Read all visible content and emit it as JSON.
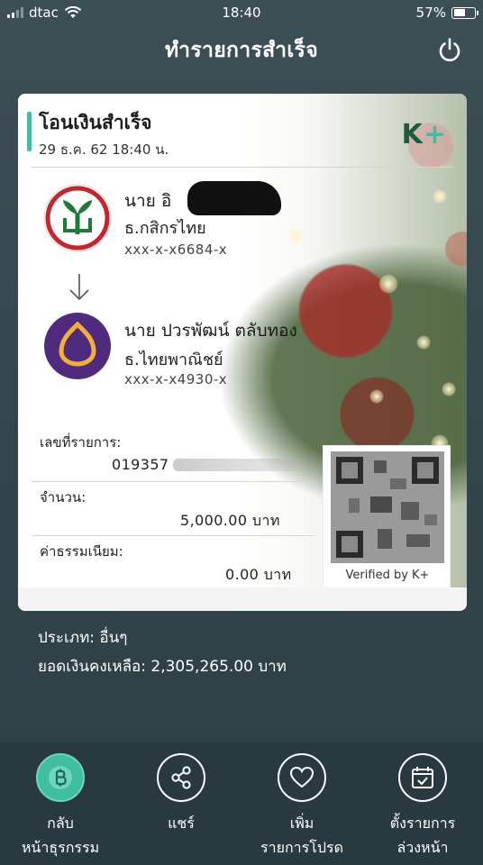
{
  "status_bar": {
    "carrier": "dtac",
    "time": "18:40",
    "battery": "57%",
    "battery_level": 0.57
  },
  "header": {
    "title": "ทำรายการสำเร็จ",
    "power_icon": "power-icon"
  },
  "slip": {
    "title": "โอนเงินสำเร็จ",
    "datetime": "29 ธ.ค. 62 18:40 น.",
    "logo": "K+",
    "sender": {
      "name": "นาย อิ",
      "bank": "ธ.กสิกรไทย",
      "account": "xxx-x-x6684-x",
      "logo_color": "#1e7a3b"
    },
    "receiver": {
      "name": "นาย ปวรพัฒน์ ตลับทอง",
      "bank": "ธ.ไทยพาณิชย์",
      "account": "xxx-x-x4930-x",
      "logo_color": "#4f2a7d"
    },
    "transaction_label": "เลขที่รายการ:",
    "transaction_value": "019357",
    "amount_label": "จำนวน:",
    "amount_value": "5,000.00  บาท",
    "fee_label": "ค่าธรรมเนียม:",
    "fee_value": "0.00 บาท",
    "qr_caption": "Verified by K+"
  },
  "info": {
    "type": "ประเภท: อื่นๆ",
    "balance": "ยอดเงินคงเหลือ: 2,305,265.00 บาท"
  },
  "bottom_nav": [
    {
      "label_line1": "กลับ",
      "label_line2": "หน้าธุรกรรม",
      "icon": "baht-icon"
    },
    {
      "label_line1": "แชร์",
      "label_line2": "",
      "icon": "share-icon"
    },
    {
      "label_line1": "เพิ่ม",
      "label_line2": "รายการโปรด",
      "icon": "heart-icon"
    },
    {
      "label_line1": "ตั้งรายการ",
      "label_line2": "ล่วงหน้า",
      "icon": "calendar-icon"
    }
  ],
  "colors": {
    "accent": "#3fbf9f",
    "background": "#34474d",
    "nav_background": "#283a40"
  }
}
